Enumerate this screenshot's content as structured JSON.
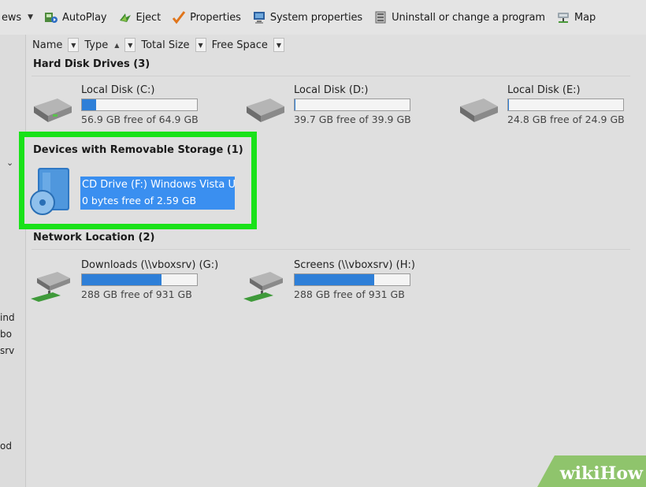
{
  "toolbar": {
    "views_fragment": "ews",
    "autoplay": "AutoPlay",
    "eject": "Eject",
    "properties": "Properties",
    "system_properties": "System properties",
    "uninstall": "Uninstall or change a program",
    "map": "Map"
  },
  "columns": {
    "name": "Name",
    "type": "Type",
    "total_size": "Total Size",
    "free_space": "Free Space"
  },
  "left_strip": {
    "frag1": "ind",
    "frag2": "bo",
    "frag3": "srv",
    "frag4": "od"
  },
  "groups": {
    "hard_disks": {
      "title": "Hard Disk Drives (3)",
      "drives": [
        {
          "name": "Local Disk (C:)",
          "free": "56.9 GB free of 64.9 GB",
          "used_fraction": 0.12
        },
        {
          "name": "Local Disk (D:)",
          "free": "39.7 GB free of 39.9 GB",
          "used_fraction": 0.01
        },
        {
          "name": "Local Disk (E:)",
          "free": "24.8 GB free of 24.9 GB",
          "used_fraction": 0.01
        }
      ]
    },
    "removable": {
      "title": "Devices with Removable Storage (1)",
      "drive": {
        "name": "CD Drive (F:) Windows Vista U",
        "free": "0 bytes free of 2.59 GB"
      }
    },
    "network": {
      "title": "Network Location (2)",
      "drives": [
        {
          "name": "Downloads (\\\\vboxsrv) (G:)",
          "free": "288 GB free of 931 GB",
          "used_fraction": 0.69
        },
        {
          "name": "Screens (\\\\vboxsrv) (H:)",
          "free": "288 GB free of 931 GB",
          "used_fraction": 0.69
        }
      ]
    }
  },
  "colors": {
    "selection": "#3a8ff0",
    "highlight_box": "#19e219",
    "bar_fill": "#2e7fd8",
    "watermark_bg": "#8fc46c"
  },
  "watermark": {
    "wiki": "wiki",
    "how": "How"
  }
}
